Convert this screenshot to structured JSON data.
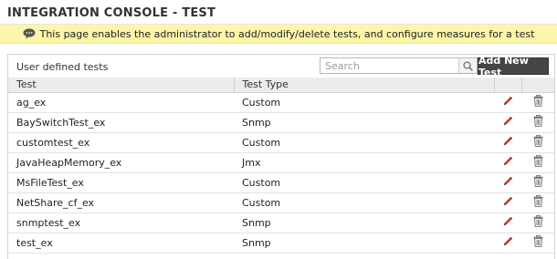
{
  "header": {
    "title": "INTEGRATION CONSOLE - TEST",
    "info_message": "This page enables the administrator to add/modify/delete tests, and configure measures for a test",
    "info_icon": "speech-bubble-icon"
  },
  "panel": {
    "caption": "User defined tests",
    "search_placeholder": "Search",
    "search_icon": "search-icon",
    "add_button_label": "Add New Test"
  },
  "table": {
    "columns": [
      "Test",
      "Test Type"
    ],
    "edit_icon": "pencil-icon",
    "delete_icon": "trash-icon",
    "rows": [
      {
        "test": "ag_ex",
        "type": "Custom"
      },
      {
        "test": "BaySwitchTest_ex",
        "type": "Snmp"
      },
      {
        "test": "customtest_ex",
        "type": "Custom"
      },
      {
        "test": "JavaHeapMemory_ex",
        "type": "Jmx"
      },
      {
        "test": "MsFileTest_ex",
        "type": "Custom"
      },
      {
        "test": "NetShare_cf_ex",
        "type": "Custom"
      },
      {
        "test": "snmptest_ex",
        "type": "Snmp"
      },
      {
        "test": "test_ex",
        "type": "Snmp"
      }
    ]
  },
  "colors": {
    "info_bar": "#fcf6a8",
    "button_bg": "#454545",
    "header_row": "#ececec",
    "pencil_red": "#c0392b"
  }
}
